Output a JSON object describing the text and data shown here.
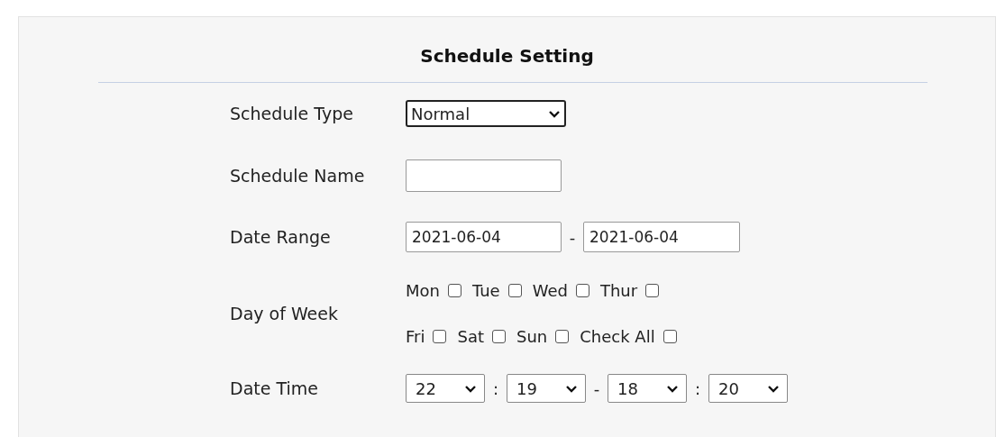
{
  "title": "Schedule Setting",
  "schedule_type": {
    "label": "Schedule Type",
    "value": "Normal"
  },
  "schedule_name": {
    "label": "Schedule Name"
  },
  "date_range": {
    "label": "Date Range",
    "start": "2021-06-04",
    "separator": "-",
    "end": "2021-06-04"
  },
  "day_of_week": {
    "label": "Day of Week",
    "rows": [
      [
        {
          "label": "Mon",
          "checked": false
        },
        {
          "label": "Tue",
          "checked": false
        },
        {
          "label": "Wed",
          "checked": false
        },
        {
          "label": "Thur",
          "checked": false
        }
      ],
      [
        {
          "label": "Fri",
          "checked": false
        },
        {
          "label": "Sat",
          "checked": false
        },
        {
          "label": "Sun",
          "checked": false
        },
        {
          "label": "Check All",
          "checked": false
        }
      ]
    ]
  },
  "date_time": {
    "label": "Date Time",
    "parts": [
      {
        "kind": "select",
        "value": "22"
      },
      {
        "kind": "separator",
        "value": ":"
      },
      {
        "kind": "select",
        "value": "19"
      },
      {
        "kind": "separator",
        "value": "-"
      },
      {
        "kind": "select",
        "value": "18"
      },
      {
        "kind": "separator",
        "value": ":"
      },
      {
        "kind": "select",
        "value": "20"
      }
    ]
  }
}
